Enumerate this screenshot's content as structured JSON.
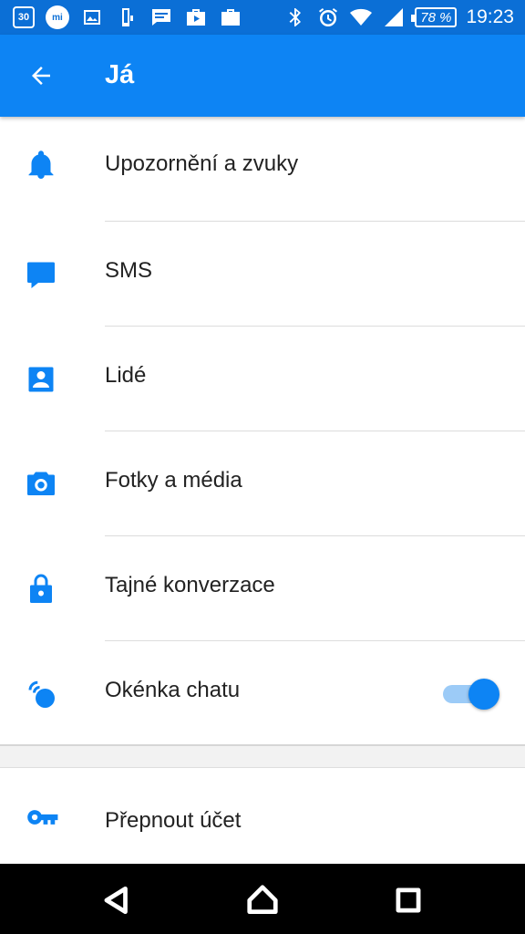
{
  "status_bar": {
    "date_badge": "30",
    "mi_badge": "mi",
    "battery": "78 %",
    "time": "19:23",
    "left_icons": [
      "calendar-icon",
      "mi-icon",
      "image-icon",
      "phone-icon",
      "message-icon",
      "briefcase-play-icon",
      "briefcase-check-icon"
    ],
    "right_icons": [
      "bluetooth-icon",
      "alarm-icon",
      "wifi-icon",
      "signal-icon",
      "battery-icon"
    ]
  },
  "app_bar": {
    "title": "Já",
    "back_icon": "arrow-back-icon"
  },
  "settings": {
    "items": [
      {
        "label": "Upozornění a zvuky",
        "icon": "bell-icon"
      },
      {
        "label": "SMS",
        "icon": "chat-bubble-icon"
      },
      {
        "label": "Lidé",
        "icon": "contact-icon"
      },
      {
        "label": "Fotky a média",
        "icon": "camera-icon"
      },
      {
        "label": "Tajné konverzace",
        "icon": "lock-icon"
      },
      {
        "label": "Okénka chatu",
        "icon": "chat-heads-icon",
        "toggle_on": true
      }
    ],
    "secondary": {
      "label": "Přepnout účet",
      "icon": "key-icon"
    }
  },
  "colors": {
    "status_bar": "#0b6fd6",
    "accent": "#0d84f4",
    "toggle_track": "#9ccbf7"
  },
  "nav_bar": {
    "icons": [
      "back-triangle-icon",
      "home-icon",
      "recents-icon"
    ]
  }
}
